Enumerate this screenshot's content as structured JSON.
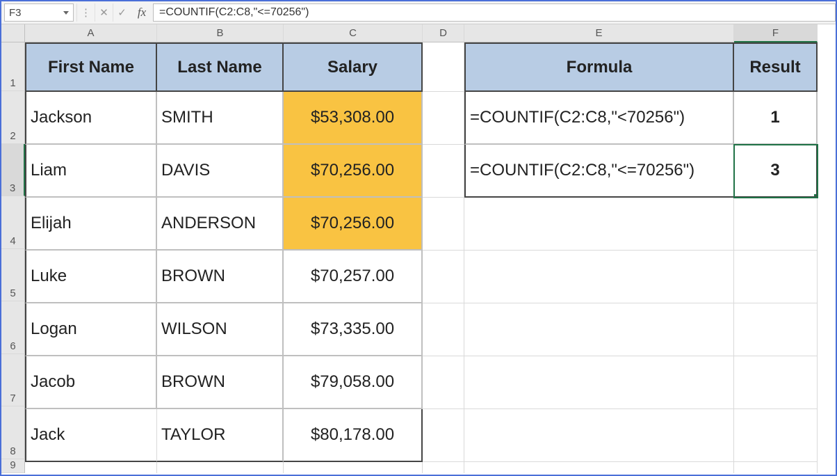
{
  "cell_ref": "F3",
  "fx_label": "fx",
  "formula_bar": "=COUNTIF(C2:C8,\"<=70256\")",
  "columns": {
    "A": "A",
    "B": "B",
    "C": "C",
    "D": "D",
    "E": "E",
    "F": "F"
  },
  "row_numbers": [
    "1",
    "2",
    "3",
    "4",
    "5",
    "6",
    "7",
    "8",
    "9"
  ],
  "headers": {
    "first": "First Name",
    "last": "Last Name",
    "salary": "Salary",
    "formula": "Formula",
    "result": "Result"
  },
  "people": [
    {
      "first": "Jackson",
      "last": "SMITH",
      "salary": "$53,308.00",
      "hi": true
    },
    {
      "first": "Liam",
      "last": "DAVIS",
      "salary": "$70,256.00",
      "hi": true
    },
    {
      "first": "Elijah",
      "last": "ANDERSON",
      "salary": "$70,256.00",
      "hi": true
    },
    {
      "first": "Luke",
      "last": "BROWN",
      "salary": "$70,257.00",
      "hi": false
    },
    {
      "first": "Logan",
      "last": "WILSON",
      "salary": "$73,335.00",
      "hi": false
    },
    {
      "first": "Jacob",
      "last": "BROWN",
      "salary": "$79,058.00",
      "hi": false
    },
    {
      "first": "Jack",
      "last": "TAYLOR",
      "salary": "$80,178.00",
      "hi": false
    }
  ],
  "formulas": [
    {
      "text": "=COUNTIF(C2:C8,\"<70256\")",
      "result": "1"
    },
    {
      "text": "=COUNTIF(C2:C8,\"<=70256\")",
      "result": "3"
    }
  ]
}
